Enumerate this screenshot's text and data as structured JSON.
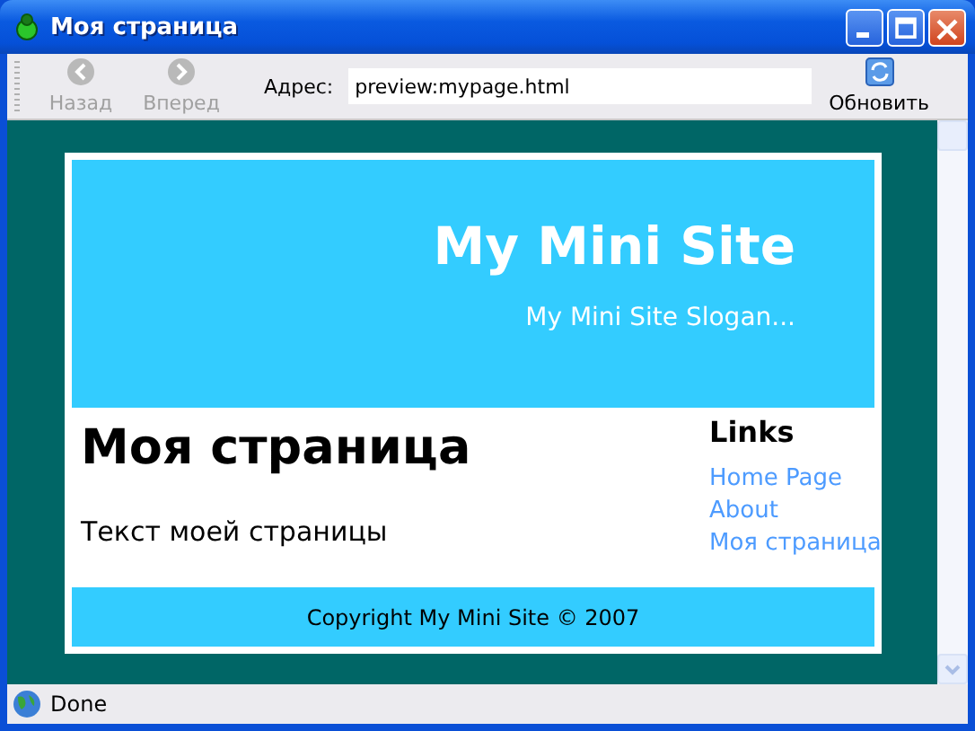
{
  "window": {
    "title": "Моя страница"
  },
  "toolbar": {
    "buttons": [
      {
        "label": "Назад",
        "kind": "back",
        "disabled": true
      },
      {
        "label": "Вперед",
        "kind": "forward",
        "disabled": true
      }
    ],
    "address_label": "Адрес:",
    "address": "preview:mypage.html",
    "refresh": "Обновить"
  },
  "page": {
    "site_title": "My Mini Site",
    "slogan": "My Mini Site Slogan...",
    "heading": "Моя страница",
    "text": "Текст моей страницы",
    "links_title": "Links",
    "links": [
      "Home Page",
      "About",
      "Моя страница"
    ],
    "footer": "Copyright My Mini Site © 2007"
  },
  "status_bar": "Done"
}
